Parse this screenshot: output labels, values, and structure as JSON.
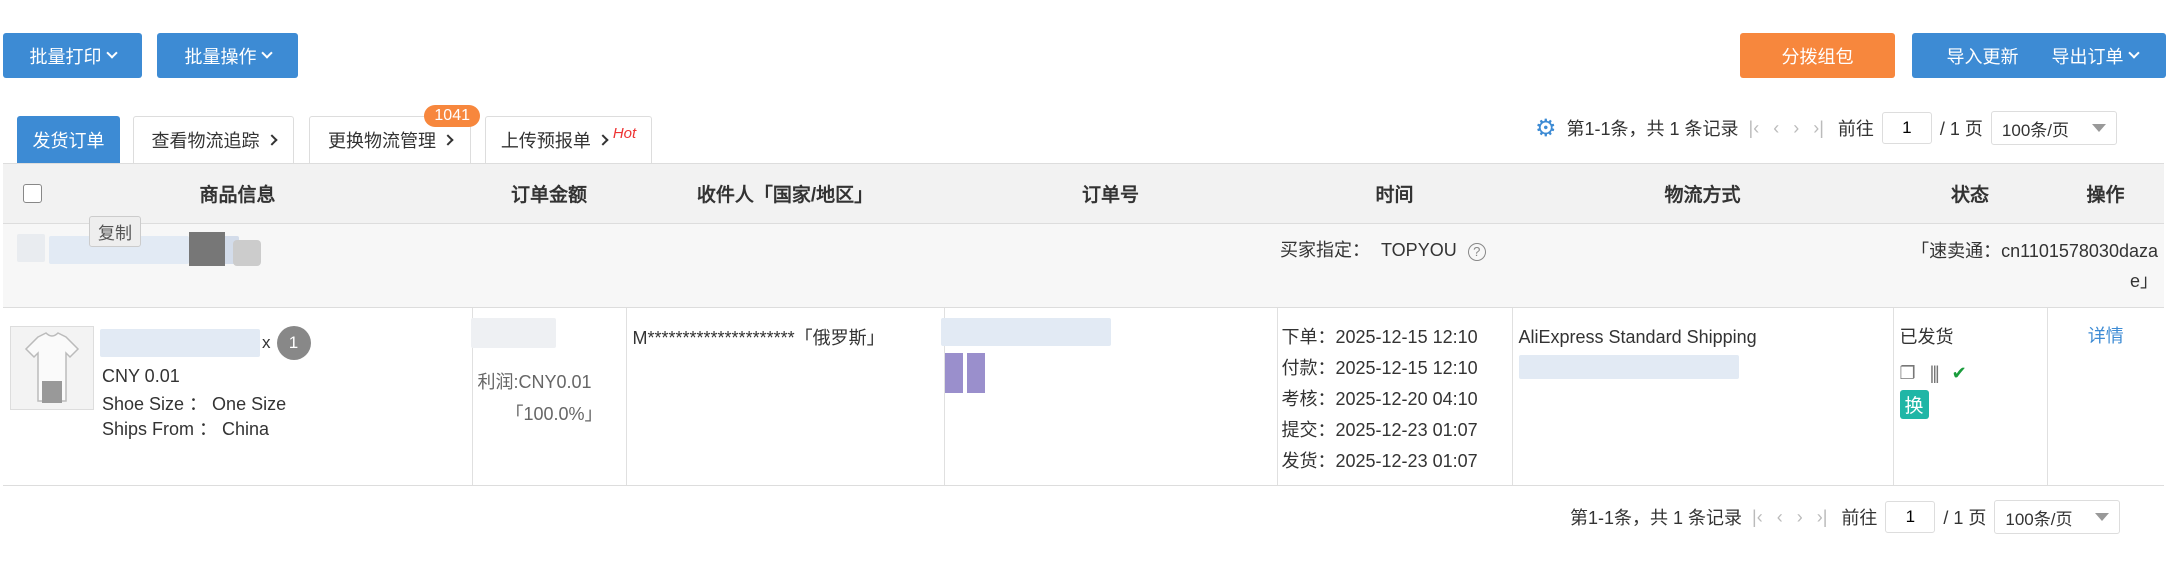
{
  "toolbar": {
    "batch_print": "批量打印",
    "batch_ops": "批量操作",
    "distribute": "分拨组包",
    "import_update": "导入更新",
    "export_orders": "导出订单"
  },
  "tabs": [
    {
      "label": "发货订单"
    },
    {
      "label": "查看物流追踪"
    },
    {
      "label": "更换物流管理",
      "badge": "1041"
    },
    {
      "label": "上传预报单",
      "hot": "Hot"
    }
  ],
  "pager": {
    "summary": "第1-1条，共 1 条记录",
    "goto_label": "前往",
    "page_value": "1",
    "total_pages": "/ 1 页",
    "page_size": "100条/页"
  },
  "table": {
    "headers": [
      "商品信息",
      "订单金额",
      "收件人「国家/地区」",
      "订单号",
      "时间",
      "物流方式",
      "状态",
      "操作"
    ],
    "group": {
      "copy_label": "复制",
      "buyer_label": "买家指定：",
      "buyer_value": "TOPYOU",
      "store_info": "「速卖通：cn1101578030dazae」"
    },
    "row": {
      "qty_prefix": "x",
      "qty": "1",
      "price": "CNY 0.01",
      "shoe_size": "Shoe Size ： One Size",
      "ships_from": "Ships From ： China",
      "profit": "利润:CNY0.01",
      "profit_pct": "「100.0%」",
      "recipient": "M*********************「俄罗斯」",
      "times": [
        {
          "label": "下单：",
          "value": "2025-12-15 12:10"
        },
        {
          "label": "付款：",
          "value": "2025-12-15 12:10"
        },
        {
          "label": "考核：",
          "value": "2025-12-20 04:10"
        },
        {
          "label": "提交：",
          "value": "2025-12-23 01:07"
        },
        {
          "label": "发货：",
          "value": "2025-12-23 01:07"
        }
      ],
      "shipping": "AliExpress Standard Shipping",
      "status": "已发货",
      "swap_badge": "换",
      "detail_link": "详情"
    }
  },
  "colors": {
    "primary": "#3d8bd4",
    "orange": "#f7873d",
    "teal": "#1fb6a6"
  }
}
